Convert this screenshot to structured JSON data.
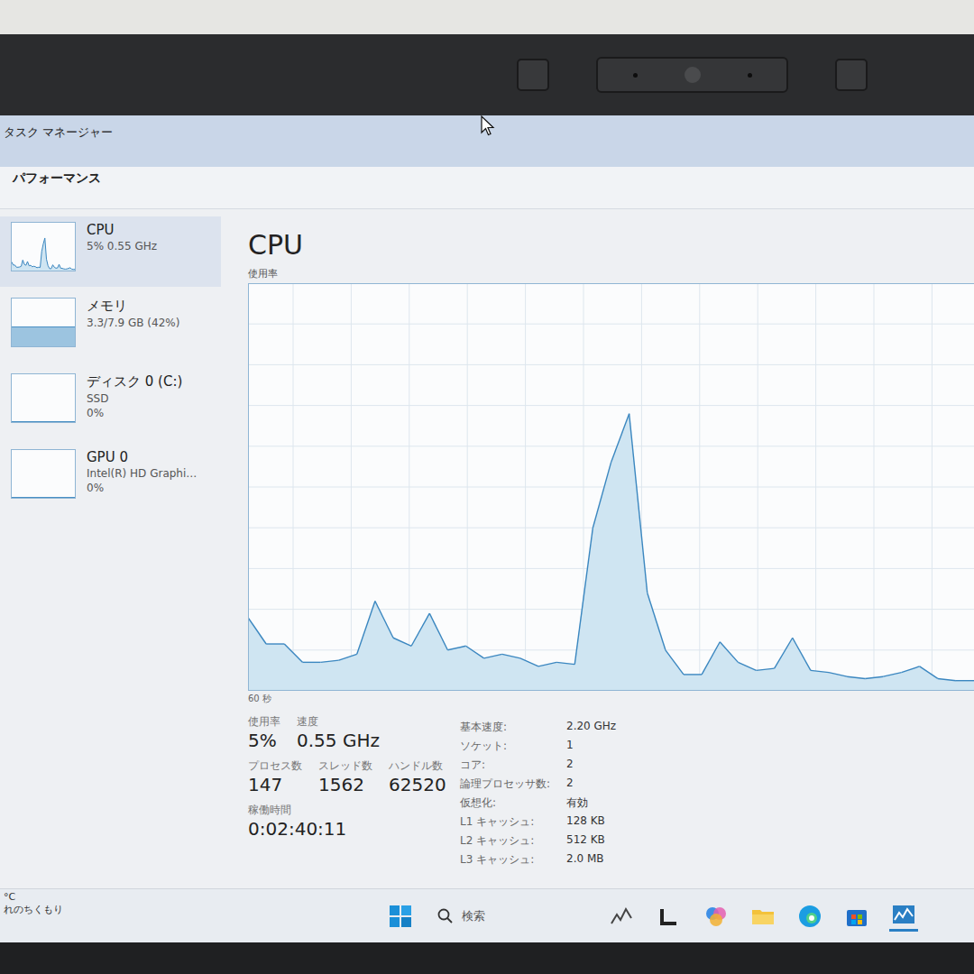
{
  "window": {
    "title": "タスク マネージャー"
  },
  "header": {
    "title": "パフォーマンス"
  },
  "sidebar": {
    "items": [
      {
        "name": "CPU",
        "lines": [
          "5% 0.55 GHz"
        ],
        "selected": true,
        "kind": "graph"
      },
      {
        "name": "メモリ",
        "lines": [
          "3.3/7.9 GB (42%)"
        ],
        "selected": false,
        "kind": "fill",
        "level": 0.42
      },
      {
        "name": "ディスク 0 (C:)",
        "lines": [
          "SSD",
          "0%"
        ],
        "selected": false,
        "kind": "fill",
        "level": 0
      },
      {
        "name": "GPU 0",
        "lines": [
          "Intel(R) HD Graphi…",
          "0%"
        ],
        "selected": false,
        "kind": "fill",
        "level": 0
      }
    ]
  },
  "panel": {
    "title": "CPU",
    "y_label": "使用率",
    "x_label": "60 秒",
    "series": [
      18,
      11.5,
      11.5,
      7,
      7,
      7.5,
      9,
      22,
      13,
      11,
      19,
      10,
      11,
      8,
      9,
      8,
      6,
      7,
      6.5,
      40,
      56,
      68,
      24,
      10,
      4,
      4,
      12,
      7,
      5,
      5.5,
      13,
      5,
      4.5,
      3.5,
      3,
      3.5,
      4.5,
      6,
      3,
      2.5,
      2.5
    ]
  },
  "stats": [
    [
      {
        "label": "使用率",
        "value": "5%"
      },
      {
        "label": "速度",
        "value": "0.55 GHz"
      }
    ],
    [
      {
        "label": "プロセス数",
        "value": "147"
      },
      {
        "label": "スレッド数",
        "value": "1562"
      },
      {
        "label": "ハンドル数",
        "value": "62520"
      }
    ],
    [
      {
        "label": "稼働時間",
        "value": "0:02:40:11"
      }
    ]
  ],
  "specs": [
    {
      "label": "基本速度:",
      "value": "2.20 GHz"
    },
    {
      "label": "ソケット:",
      "value": "1"
    },
    {
      "label": "コア:",
      "value": "2"
    },
    {
      "label": "論理プロセッサ数:",
      "value": "2"
    },
    {
      "label": "仮想化:",
      "value": "有効"
    },
    {
      "label": "L1 キャッシュ:",
      "value": "128 KB"
    },
    {
      "label": "L2 キャッシュ:",
      "value": "512 KB"
    },
    {
      "label": "L3 キャッシュ:",
      "value": "2.0 MB"
    }
  ],
  "taskbar": {
    "search": "検索",
    "weather": {
      "temp": "°C",
      "text": "れのちくもり"
    }
  }
}
